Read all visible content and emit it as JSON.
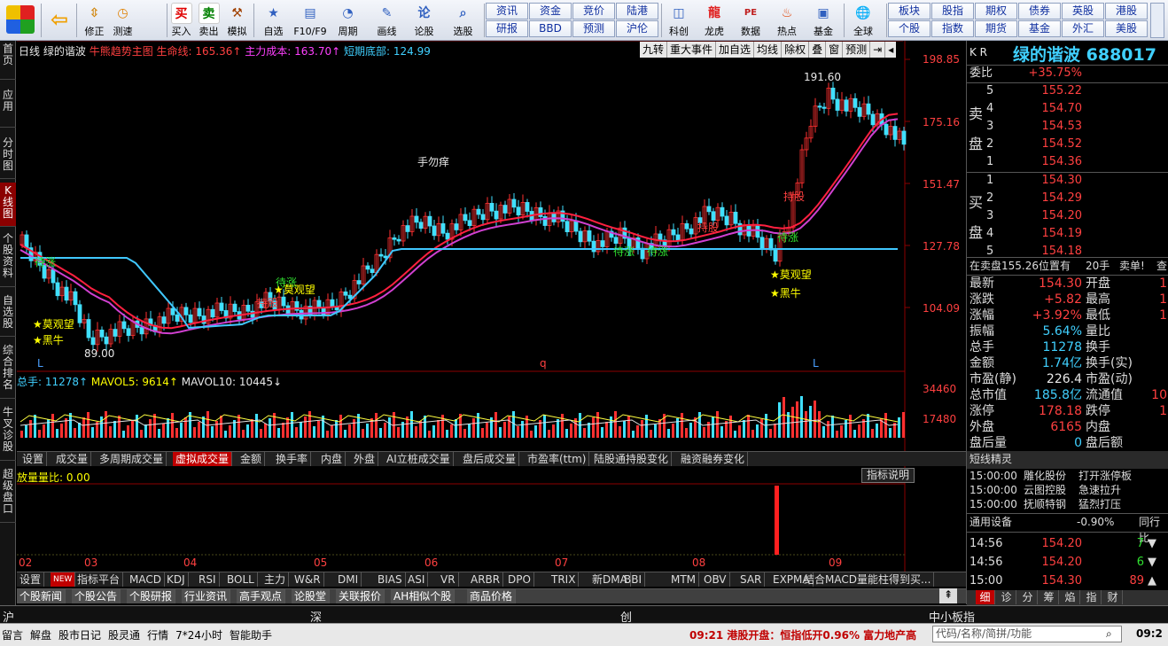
{
  "toolbar": {
    "left": [
      {
        "name": "app-logo",
        "label": ""
      },
      {
        "name": "back",
        "label": ""
      },
      {
        "name": "fix",
        "label": "修正"
      },
      {
        "name": "test",
        "label": "测速"
      },
      {
        "name": "buy",
        "label": "买入"
      },
      {
        "name": "sell",
        "label": "卖出"
      },
      {
        "name": "sim",
        "label": "模拟"
      },
      {
        "name": "watch",
        "label": "自选"
      },
      {
        "name": "f10",
        "label": "F10/F9"
      },
      {
        "name": "cycle",
        "label": "周期"
      },
      {
        "name": "draw",
        "label": "画线"
      },
      {
        "name": "forum",
        "label": "论股"
      },
      {
        "name": "pick",
        "label": "选股"
      }
    ],
    "grid1": [
      "资讯",
      "资金",
      "竞价",
      "陆港",
      "研报",
      "BBD",
      "预测",
      "沪伦"
    ],
    "mid": [
      {
        "name": "kechuang",
        "label": "科创"
      },
      {
        "name": "dragon",
        "label": "龙虎"
      },
      {
        "name": "data",
        "label": "数据"
      },
      {
        "name": "hot",
        "label": "热点"
      },
      {
        "name": "fund",
        "label": "基金"
      },
      {
        "name": "global",
        "label": "全球"
      }
    ],
    "grid2": [
      "板块",
      "股指",
      "期权",
      "债券",
      "英股",
      "港股",
      "个股",
      "指数",
      "期货",
      "基金",
      "外汇",
      "美股"
    ]
  },
  "leftnav": [
    "首页",
    "应用",
    "分时图",
    "K线图",
    "个股资料",
    "自选股",
    "综合排名",
    "牛叉诊股",
    "超级盘口"
  ],
  "chart": {
    "header": {
      "period": "日线",
      "stock": "绿的谐波",
      "indicator": "牛熊趋势主图",
      "lifeline": "生命线: 165.36↑",
      "cost": "主力成本: 163.70↑",
      "bottom": "短期底部: 124.99"
    },
    "right_buttons": [
      "九转",
      "重大事件",
      "加自选",
      "均线",
      "除权",
      "叠",
      "窗",
      "预测",
      "⇥",
      "◂"
    ],
    "price_labels": [
      "198.85",
      "175.16",
      "151.47",
      "127.78",
      "104.09"
    ],
    "annotations": [
      {
        "t": "手勿痒",
        "c": "wht"
      },
      {
        "t": "191.60",
        "c": "wht"
      },
      {
        "t": "89.00",
        "c": "wht"
      },
      {
        "t": "待涨",
        "c": "grn"
      },
      {
        "t": "待涨",
        "c": "grn"
      },
      {
        "t": "待涨",
        "c": "grn"
      },
      {
        "t": "待涨",
        "c": "grn"
      },
      {
        "t": "待涨",
        "c": "grn"
      },
      {
        "t": "持股",
        "c": "red"
      },
      {
        "t": "持股",
        "c": "red"
      },
      {
        "t": "持股",
        "c": "red"
      },
      {
        "t": "★莫观望",
        "c": "yel"
      },
      {
        "t": "★黑牛",
        "c": "yel"
      },
      {
        "t": "★莫观望",
        "c": "yel"
      },
      {
        "t": "★莫观望",
        "c": "yel"
      },
      {
        "t": "★黑牛",
        "c": "yel"
      },
      {
        "t": "L",
        "c": "blu"
      },
      {
        "t": "q",
        "c": "red"
      },
      {
        "t": "L",
        "c": "blu"
      }
    ],
    "vol_header": {
      "total": "总手: 11278↑",
      "ma5": "MAVOL5: 9614↑",
      "ma10": "MAVOL10: 10445↓"
    },
    "vol_labels": [
      "34460",
      "17480"
    ],
    "tabs1": [
      "设置",
      "成交量",
      "多周期成交量",
      "虚拟成交量",
      "金额",
      "换手率",
      "内盘",
      "外盘",
      "AI立桩成交量",
      "盘后成交量",
      "市盈率(ttm)",
      "陆股通持股变化",
      "融资融券变化"
    ],
    "ind_header": "放量量比: 0.00",
    "ind_button": "指标说明",
    "months": [
      "02",
      "03",
      "04",
      "05",
      "06",
      "07",
      "08",
      "09"
    ],
    "tabs2": [
      "设置",
      "NEW",
      "指标平台",
      "MACD",
      "KDJ",
      "RSI",
      "BOLL",
      "主力",
      "W&R",
      "DMI",
      "BIAS",
      "ASI",
      "VR",
      "ARBR",
      "DPO",
      "TRIX",
      "新DMA",
      "BBI",
      "MTM",
      "OBV",
      "SAR",
      "EXPMA",
      "结合MACD量能柱得到买..."
    ],
    "tabs3": [
      "个股新闻",
      "个股公告",
      "个股研报",
      "行业资讯",
      "高手观点",
      "论股堂",
      "关联报价",
      "AH相似个股",
      "商品价格"
    ]
  },
  "quote": {
    "kr": "K R",
    "name": "绿的谐波",
    "code": "688017",
    "weibi_label": "委比",
    "weibi": "+35.75%",
    "sell_label": "卖盘",
    "buy_label": "买盘",
    "sells": [
      {
        "n": "5",
        "p": "155.22"
      },
      {
        "n": "4",
        "p": "154.70"
      },
      {
        "n": "3",
        "p": "154.53"
      },
      {
        "n": "2",
        "p": "154.52"
      },
      {
        "n": "1",
        "p": "154.36"
      }
    ],
    "buys": [
      {
        "n": "1",
        "p": "154.30"
      },
      {
        "n": "2",
        "p": "154.29"
      },
      {
        "n": "3",
        "p": "154.20"
      },
      {
        "n": "4",
        "p": "154.19"
      },
      {
        "n": "5",
        "p": "154.18"
      }
    ],
    "order_line": "在卖盘155.26位置有",
    "order_qty": "20手",
    "order_tag": "卖单!",
    "order_more": "查",
    "stats": [
      {
        "l": "最新",
        "v": "154.30",
        "c": "red",
        "l2": "开盘",
        "v2": "1"
      },
      {
        "l": "涨跌",
        "v": "+5.82",
        "c": "red",
        "l2": "最高",
        "v2": "1"
      },
      {
        "l": "涨幅",
        "v": "+3.92%",
        "c": "red",
        "l2": "最低",
        "v2": "1"
      },
      {
        "l": "振幅",
        "v": "5.64%",
        "c": "cya",
        "l2": "量比",
        "v2": ""
      },
      {
        "l": "总手",
        "v": "11278",
        "c": "cya",
        "l2": "换手",
        "v2": ""
      },
      {
        "l": "金额",
        "v": "1.74亿",
        "c": "cya",
        "l2": "换手(实)",
        "v2": ""
      },
      {
        "l": "市盈(静)",
        "v": "226.4",
        "c": "wht",
        "l2": "市盈(动)",
        "v2": ""
      },
      {
        "l": "总市值",
        "v": "185.8亿",
        "c": "cya",
        "l2": "流通值",
        "v2": "10"
      },
      {
        "l": "涨停",
        "v": "178.18",
        "c": "red",
        "l2": "跌停",
        "v2": "1"
      },
      {
        "l": "外盘",
        "v": "6165",
        "c": "red",
        "l2": "内盘",
        "v2": ""
      },
      {
        "l": "盘后量",
        "v": "0",
        "c": "cya",
        "l2": "盘后额",
        "v2": ""
      }
    ],
    "jingling_title": "短线精灵",
    "jingling": [
      {
        "t": "15:00:00",
        "a": "雕化股份",
        "b": "打开涨停板"
      },
      {
        "t": "15:00:00",
        "a": "云图控股",
        "b": "急速拉升"
      },
      {
        "t": "15:00:00",
        "a": "抚顺特钢",
        "b": "猛烈打压"
      }
    ],
    "sector": {
      "name": "通用设备",
      "pct": "-0.90%",
      "more": "同行比"
    },
    "ticks": [
      {
        "t": "14:56",
        "p": "154.20",
        "v": "7",
        "c": "grn",
        "arrow": "▼"
      },
      {
        "t": "14:56",
        "p": "154.20",
        "v": "6",
        "c": "grn",
        "arrow": "▼"
      },
      {
        "t": "15:00",
        "p": "154.30",
        "v": "89",
        "c": "red",
        "arrow": "▲"
      }
    ],
    "tabs": [
      "细",
      "诊",
      "分",
      "筹",
      "焰",
      "指",
      "财"
    ]
  },
  "bottom": {
    "idx": [
      {
        "n": "沪"
      },
      {
        "n": "深"
      },
      {
        "n": "创"
      },
      {
        "n": "中小板指"
      }
    ],
    "status": [
      "留言",
      "解盘",
      "股市日记",
      "股灵通",
      "行情",
      "7*24小时",
      "智能助手"
    ],
    "news": "09:21 港股开盘：恒指低开0.96% 富力地产高",
    "search": "代码/名称/简拼/功能",
    "clock": "09:2"
  }
}
